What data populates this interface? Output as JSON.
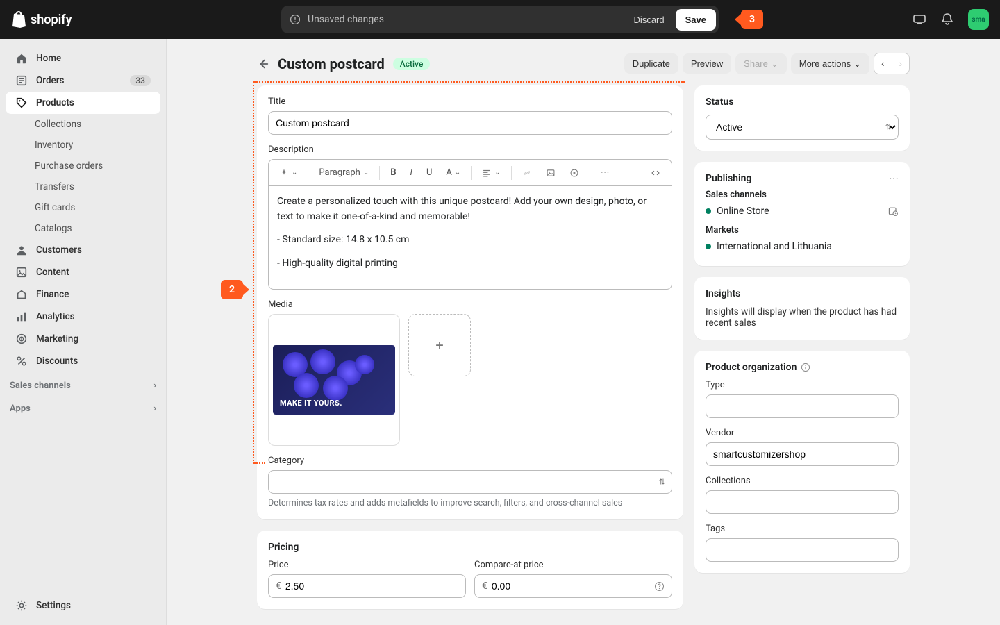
{
  "header": {
    "brand": "shopify",
    "unsaved_label": "Unsaved changes",
    "discard": "Discard",
    "save": "Save",
    "callout_save": "3",
    "avatar_initials": "sma"
  },
  "sidebar": {
    "home": "Home",
    "orders": "Orders",
    "orders_badge": "33",
    "products": "Products",
    "sub": {
      "collections": "Collections",
      "inventory": "Inventory",
      "purchase_orders": "Purchase orders",
      "transfers": "Transfers",
      "gift_cards": "Gift cards",
      "catalogs": "Catalogs"
    },
    "customers": "Customers",
    "content": "Content",
    "finance": "Finance",
    "analytics": "Analytics",
    "marketing": "Marketing",
    "discounts": "Discounts",
    "sales_channels": "Sales channels",
    "apps": "Apps",
    "settings": "Settings"
  },
  "page": {
    "title": "Custom postcard",
    "status_label": "Active",
    "actions": {
      "duplicate": "Duplicate",
      "preview": "Preview",
      "share": "Share",
      "more": "More actions"
    }
  },
  "form": {
    "title_label": "Title",
    "title_value": "Custom postcard",
    "description_label": "Description",
    "desc_paragraph": "Paragraph",
    "desc_text_p1": "Create a personalized touch with this unique postcard! Add your own design, photo, or text to make it one-of-a-kind and memorable!",
    "desc_text_p2": "- Standard size: 14.8 x 10.5 cm",
    "desc_text_p3": "- High-quality digital printing",
    "media_label": "Media",
    "media_caption": "MAKE IT YOURS.",
    "category_label": "Category",
    "category_help": "Determines tax rates and adds metafields to improve search, filters, and cross-channel sales",
    "pricing_heading": "Pricing",
    "price_label": "Price",
    "compare_label": "Compare-at price",
    "currency": "€",
    "price_value": "2.50",
    "compare_value": "0.00"
  },
  "side": {
    "status_heading": "Status",
    "status_value": "Active",
    "publishing_heading": "Publishing",
    "sales_channels_heading": "Sales channels",
    "online_store": "Online Store",
    "markets_heading": "Markets",
    "markets_value": "International and Lithuania",
    "insights_heading": "Insights",
    "insights_text": "Insights will display when the product has had recent sales",
    "prod_org_heading": "Product organization",
    "type_label": "Type",
    "vendor_label": "Vendor",
    "vendor_value": "smartcustomizershop",
    "collections_label": "Collections",
    "tags_label": "Tags"
  },
  "annotations": {
    "step2": "2"
  }
}
